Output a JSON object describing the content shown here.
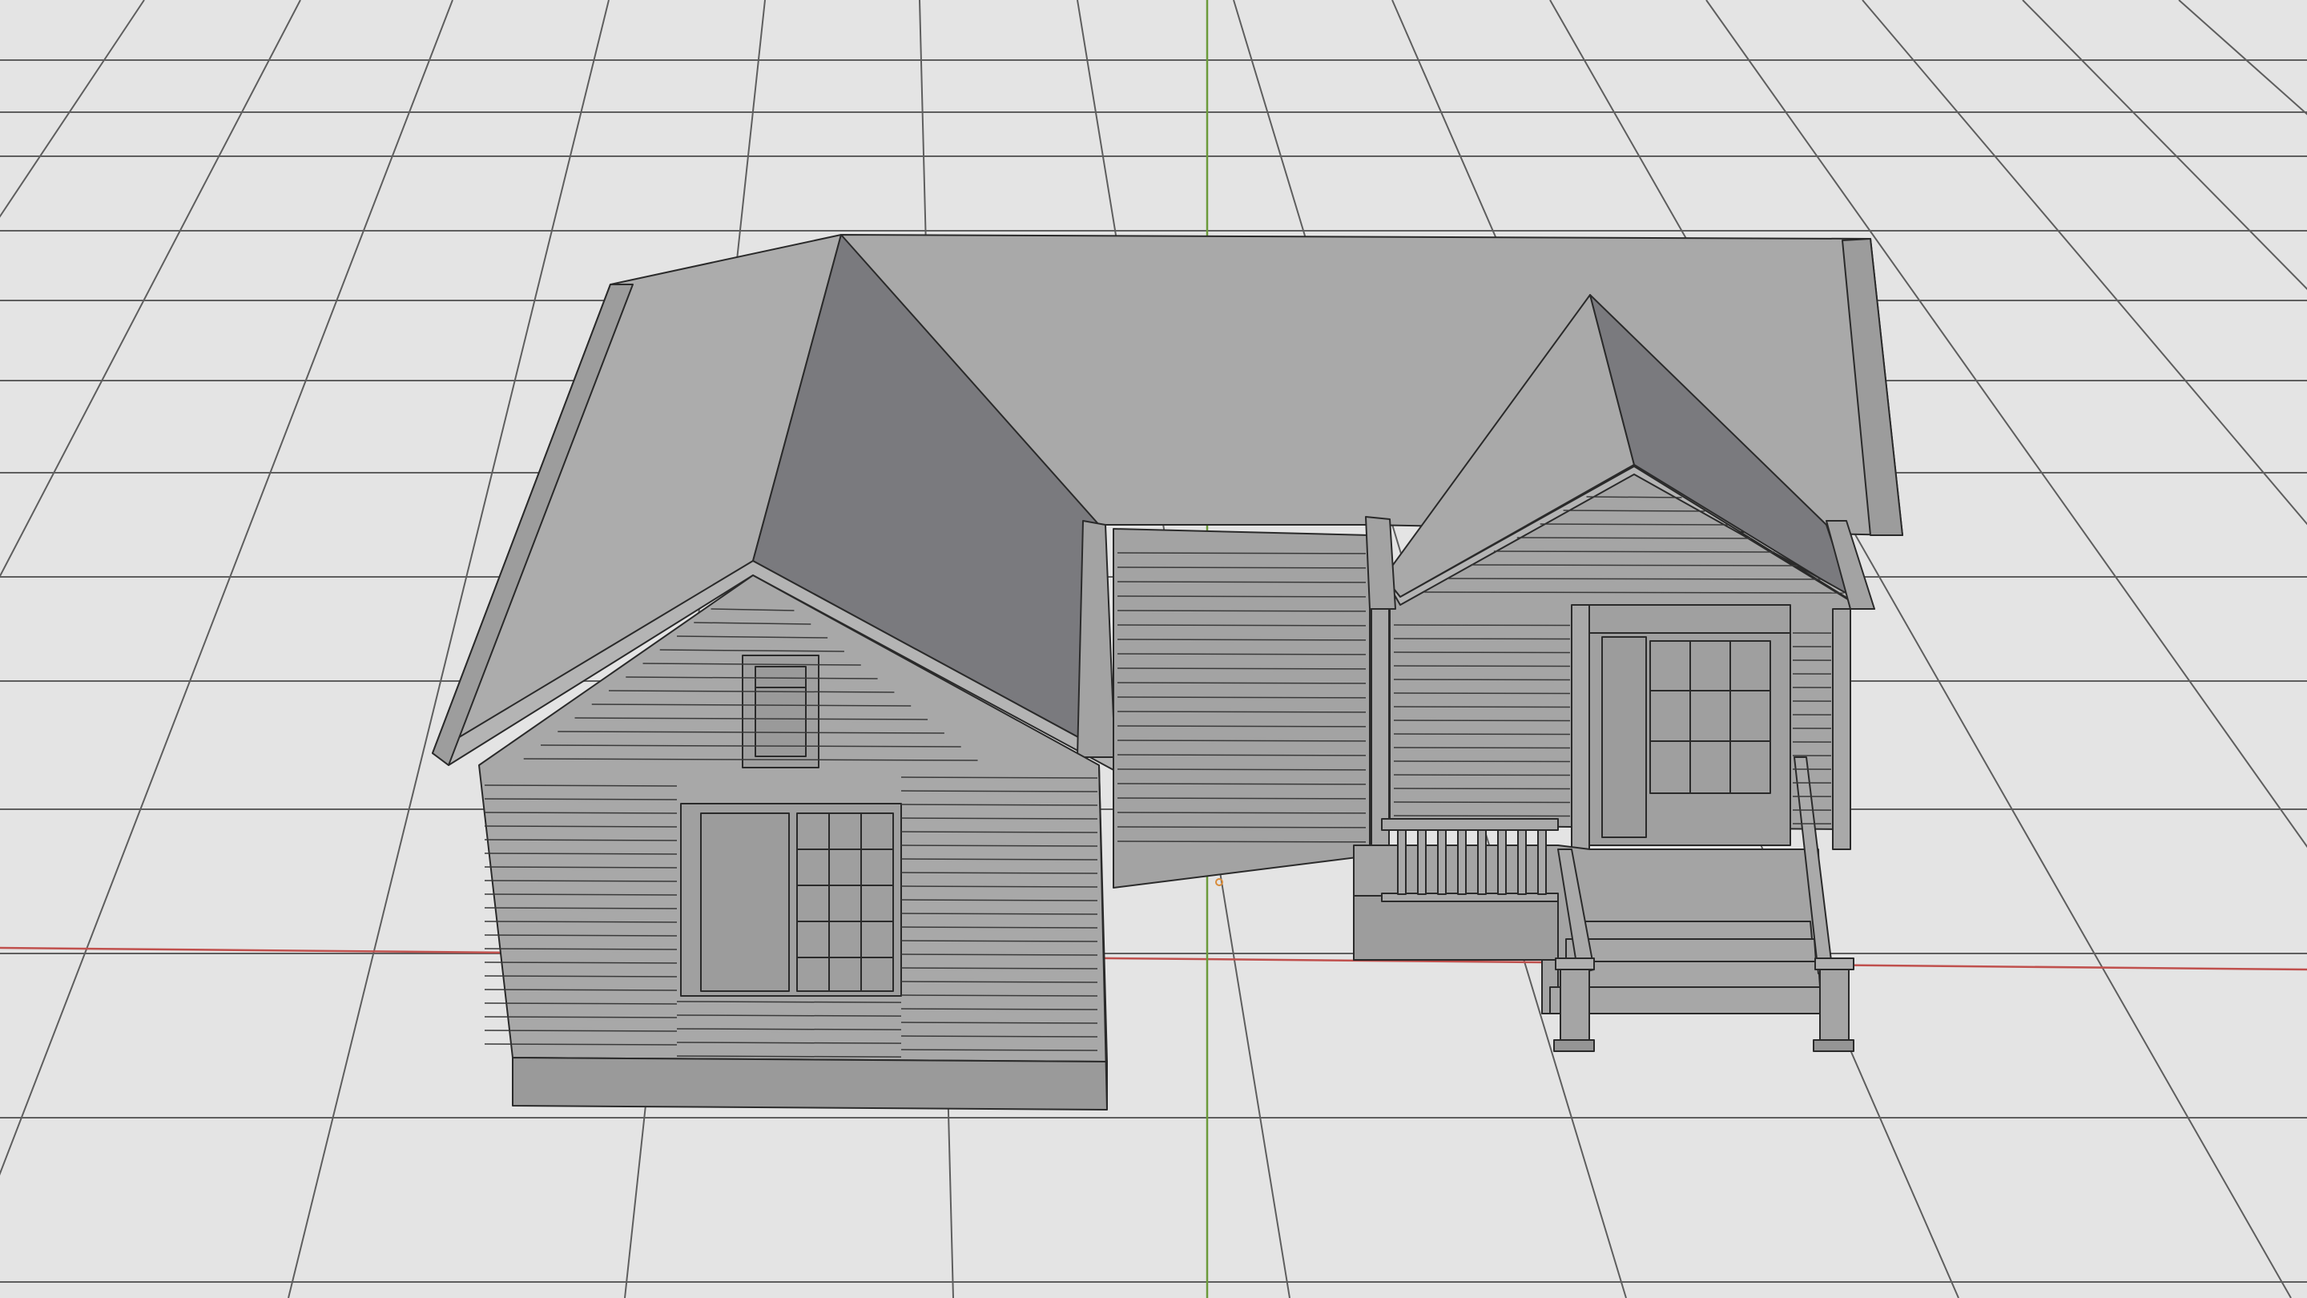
{
  "viewport": {
    "kind": "3d-viewport",
    "shading": "solid",
    "background_color": "#e4e4e4",
    "grid_line_color": "#5e5e5e",
    "x_axis_color": "#c0504d",
    "y_axis_color": "#6b9a3a",
    "origin_marker_color": "#d98c3a"
  },
  "scene": {
    "object": "house",
    "parts": [
      "main-roof",
      "left-gable-roof",
      "front-gable-roof",
      "left-wing",
      "center-wall",
      "entry-wall",
      "front-door",
      "left-window",
      "attic-window",
      "porch",
      "porch-railing",
      "porch-steps",
      "porch-posts"
    ],
    "wall_color": "#a6a6a6",
    "roof_light_color": "#ababab",
    "roof_dark_color": "#7a7a7e",
    "edge_color": "#2a2a2a"
  }
}
